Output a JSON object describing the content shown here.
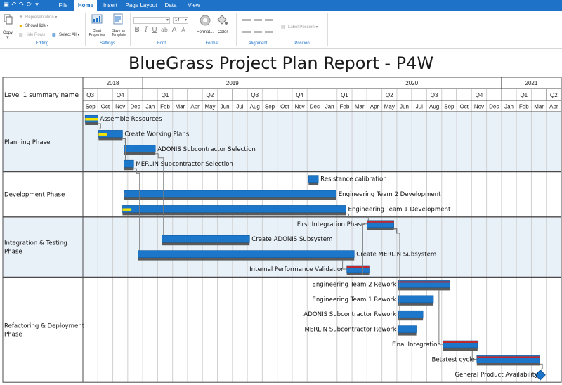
{
  "titlebar": {
    "tabs": [
      {
        "label": "File",
        "active": false
      },
      {
        "label": "Home",
        "active": true
      },
      {
        "label": "Insert",
        "active": false
      },
      {
        "label": "Page Layout",
        "active": false
      },
      {
        "label": "Data",
        "active": false
      },
      {
        "label": "View",
        "active": false
      }
    ],
    "quick_access_icons": [
      "save-icon",
      "undo-icon",
      "redo-icon",
      "refresh-icon",
      "customize-icon"
    ]
  },
  "ribbon": {
    "editing": {
      "copy_label": "Copy",
      "representation_label": "Representation",
      "show_hide_label": "Show/Hide",
      "hide_rows_label": "Hide Rows",
      "select_all_label": "Select All",
      "group_label": "Editing"
    },
    "settings": {
      "chart_properties_label": "Chart Properties",
      "save_as_template_label": "Save as Template",
      "group_label": "Settings"
    },
    "font": {
      "font_name_value": "",
      "font_size_value": "14",
      "bold_label": "B",
      "italic_label": "I",
      "underline_label": "U",
      "strike_label": "ab",
      "grow_label": "A",
      "shrink_label": "A",
      "group_label": "Font"
    },
    "format": {
      "format_label": "Format",
      "color_label": "Color",
      "group_label": "Format"
    },
    "alignment": {
      "group_label": "Alignment"
    },
    "position": {
      "label_position_label": "Label Position",
      "group_label": "Position"
    }
  },
  "report": {
    "title": "BlueGrass Project Plan Report - P4W",
    "column_header": "Level 1 summary name",
    "colors": {
      "bar_blue": "#1c76c9",
      "bar_shadow": "#5a5a5a",
      "progress_yellow": "#f5e400",
      "progress_red": "#c0272d",
      "phase_bg": "#e8f0f8",
      "milestone": "#1c76c9",
      "dependency_line": "#7a7a7a"
    },
    "years": [
      "2018",
      "2019",
      "2020",
      "2021"
    ],
    "quarters": [
      "Q3",
      "Q4",
      "Q1",
      "Q2",
      "Q3",
      "Q4",
      "Q1",
      "Q2",
      "Q3",
      "Q4",
      "Q1",
      "Q2"
    ],
    "months": [
      "Sep",
      "Oct",
      "Nov",
      "Dec",
      "Jan",
      "Feb",
      "Mar",
      "Apr",
      "May",
      "Jun",
      "Jul",
      "Aug",
      "Sep",
      "Oct",
      "Nov",
      "Dec",
      "Jan",
      "Feb",
      "Mar",
      "Apr",
      "May",
      "Jun",
      "Jul",
      "Aug",
      "Sep",
      "Oct",
      "Nov",
      "Dec",
      "Jan",
      "Feb",
      "Mar",
      "Apr"
    ],
    "phases": [
      {
        "name": "Planning Phase"
      },
      {
        "name": "Development Phase"
      },
      {
        "name": "Integration & Testing Phase"
      },
      {
        "name": "Refactoring & Deployment Phase"
      }
    ],
    "tasks": [
      {
        "name": "Assemble Resources",
        "phase": 0,
        "start_month": 0.15,
        "end_month": 1.0,
        "label_side": "right",
        "progress_color": "yellow",
        "progress_fraction": 1.0
      },
      {
        "name": "Create Working Plans",
        "phase": 0,
        "start_month": 1.05,
        "end_month": 2.65,
        "label_side": "right",
        "progress_color": "yellow",
        "progress_fraction": 0.35
      },
      {
        "name": "ADONIS Subcontractor Selection",
        "phase": 0,
        "start_month": 2.75,
        "end_month": 4.85,
        "label_side": "right",
        "progress_color": "none",
        "progress_fraction": 0
      },
      {
        "name": "MERLIN Subcontractor Selection",
        "phase": 0,
        "start_month": 2.75,
        "end_month": 3.4,
        "label_side": "right",
        "progress_color": "none",
        "progress_fraction": 0
      },
      {
        "name": "Resistance calibration",
        "phase": 1,
        "start_month": 15.1,
        "end_month": 15.75,
        "label_side": "right",
        "progress_color": "none",
        "progress_fraction": 0
      },
      {
        "name": "Engineering Team 2 Development",
        "phase": 1,
        "start_month": 2.75,
        "end_month": 16.95,
        "label_side": "right",
        "progress_color": "none",
        "progress_fraction": 0
      },
      {
        "name": "Engineering Team 1 Development",
        "phase": 1,
        "start_month": 2.65,
        "end_month": 17.6,
        "label_side": "right",
        "progress_color": "yellow",
        "progress_fraction": 0.04
      },
      {
        "name": "First Integration Phase",
        "phase": 2,
        "start_month": 19.0,
        "end_month": 20.8,
        "label_side": "left",
        "progress_color": "red",
        "progress_fraction": 1.0
      },
      {
        "name": "Create ADONIS Subsystem",
        "phase": 2,
        "start_month": 5.3,
        "end_month": 11.15,
        "label_side": "right",
        "progress_color": "none",
        "progress_fraction": 0
      },
      {
        "name": "Create MERLIN Subsystem",
        "phase": 2,
        "start_month": 3.7,
        "end_month": 18.15,
        "label_side": "right",
        "progress_color": "none",
        "progress_fraction": 0
      },
      {
        "name": "Internal Performance Validation",
        "phase": 2,
        "start_month": 17.65,
        "end_month": 19.15,
        "label_side": "left",
        "progress_color": "red",
        "progress_fraction": 1.0
      },
      {
        "name": "Engineering Team 2 Rework",
        "phase": 3,
        "start_month": 21.1,
        "end_month": 24.55,
        "label_side": "left",
        "progress_color": "red",
        "progress_fraction": 1.0
      },
      {
        "name": "Engineering Team 1 Rework",
        "phase": 3,
        "start_month": 21.1,
        "end_month": 23.45,
        "label_side": "left",
        "progress_color": "none",
        "progress_fraction": 0
      },
      {
        "name": "ADONIS Subcontractor Rework",
        "phase": 3,
        "start_month": 21.1,
        "end_month": 22.75,
        "label_side": "left",
        "progress_color": "none",
        "progress_fraction": 0
      },
      {
        "name": "MERLIN Subcontractor Rework",
        "phase": 3,
        "start_month": 21.1,
        "end_month": 22.3,
        "label_side": "left",
        "progress_color": "none",
        "progress_fraction": 0
      },
      {
        "name": "Final Integration",
        "phase": 3,
        "start_month": 24.1,
        "end_month": 26.4,
        "label_side": "left",
        "progress_color": "red",
        "progress_fraction": 1.0
      },
      {
        "name": "Betatest cycle",
        "phase": 3,
        "start_month": 26.35,
        "end_month": 30.55,
        "label_side": "left",
        "progress_color": "red",
        "progress_fraction": 1.0
      },
      {
        "name": "General Product Availability",
        "phase": 3,
        "start_month": 30.6,
        "end_month": 30.6,
        "label_side": "left",
        "progress_color": "none",
        "progress_fraction": 0,
        "milestone": true
      }
    ]
  }
}
